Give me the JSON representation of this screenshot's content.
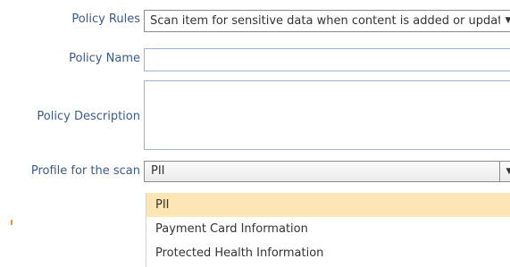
{
  "form": {
    "policy_rules": {
      "label": "Policy Rules",
      "value": "Scan item for sensitive data when content is added or updated"
    },
    "policy_name": {
      "label": "Policy Name",
      "value": ""
    },
    "policy_description": {
      "label": "Policy Description",
      "value": ""
    },
    "profile": {
      "label": "Profile for the scan",
      "value": "PII",
      "options": [
        "PII",
        "Payment Card Information",
        "Protected Health Information"
      ],
      "highlighted_option": "PII"
    }
  },
  "icons": {
    "dropdown_arrow": "chevron-down-icon"
  },
  "colors": {
    "label_text": "#3b5a8c",
    "field_border": "#9fb4cf",
    "selected_option_bg": "#fde5b6",
    "accent_mark": "#f08a3c"
  }
}
